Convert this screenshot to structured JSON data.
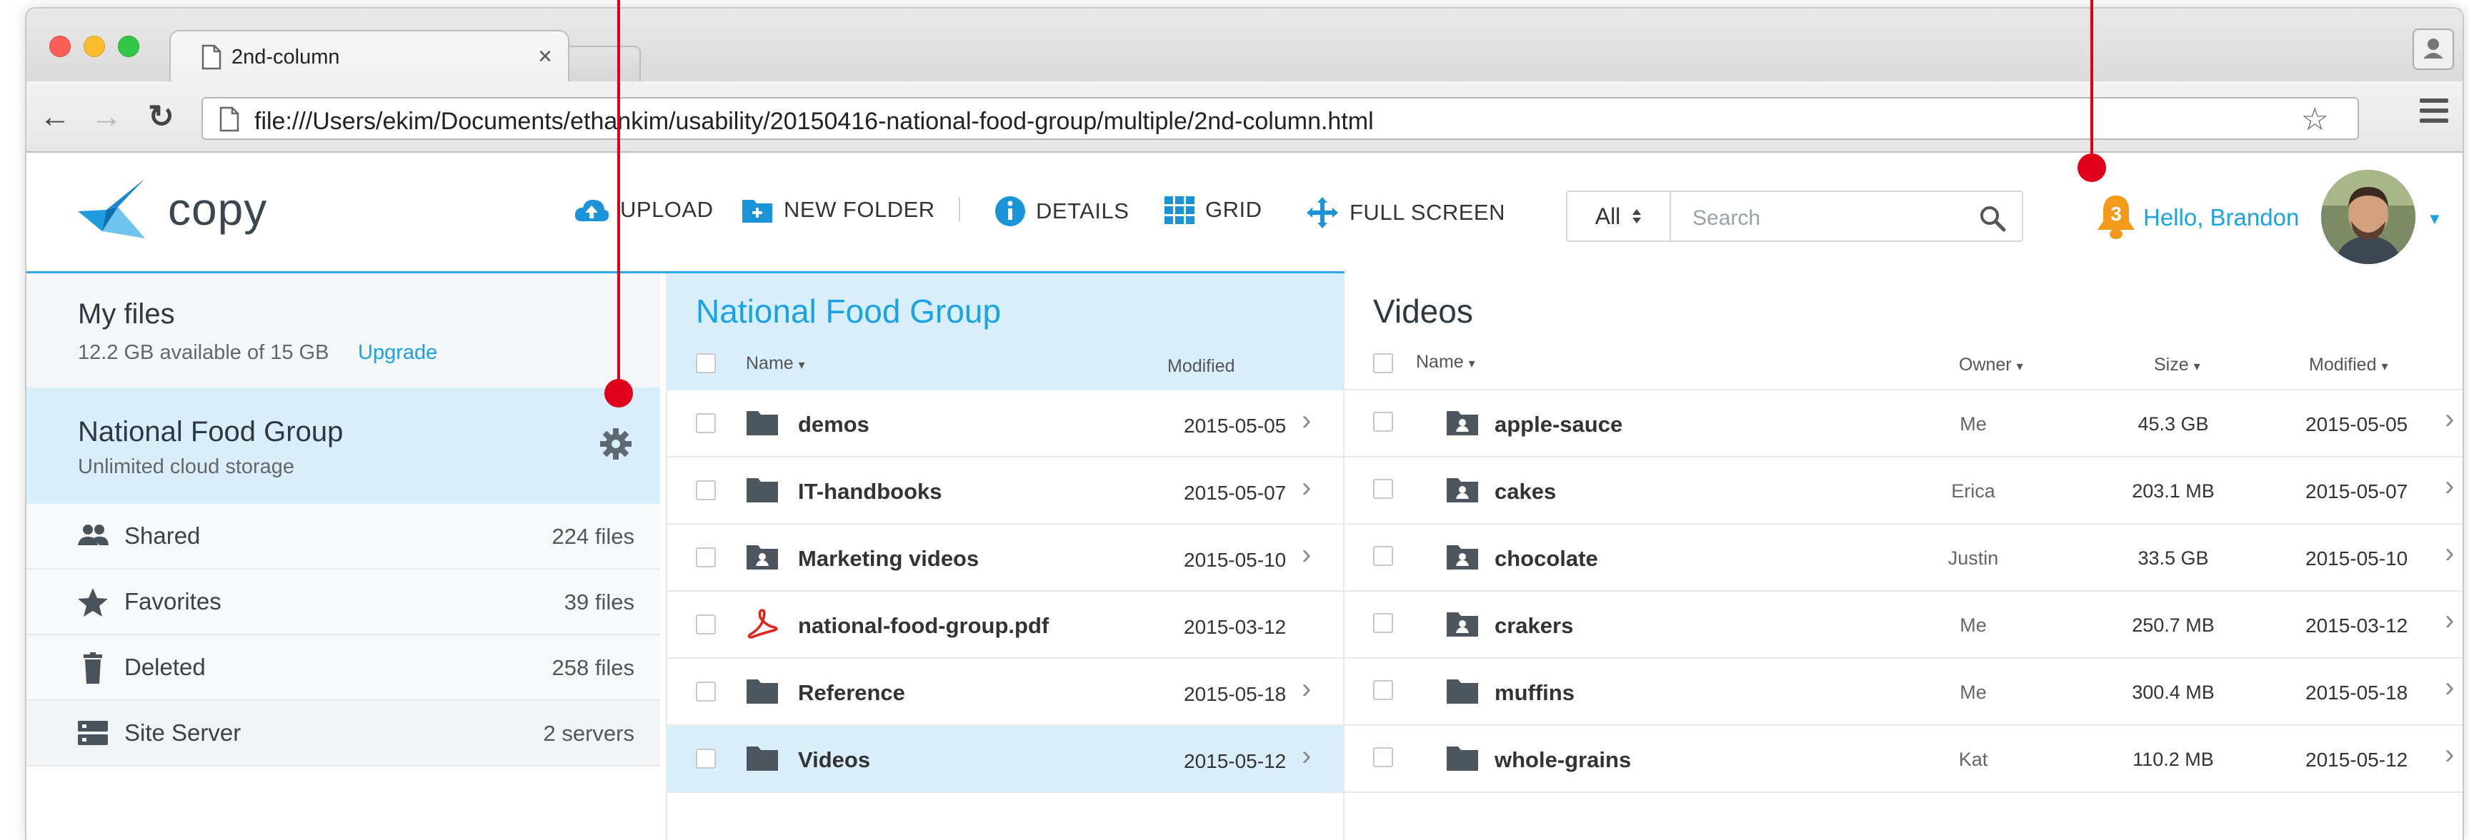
{
  "browser": {
    "tab_title": "2nd-column",
    "tab_close": "×",
    "url": "file:///Users/ekim/Documents/ethankim/usability/20150416-national-food-group/multiple/2nd-column.html",
    "traffic_colors": [
      "#fc5f57",
      "#fdbc2e",
      "#33c748"
    ]
  },
  "app": {
    "logo_text": "copy",
    "toolbar": {
      "upload": "UPLOAD",
      "new_folder": "NEW FOLDER",
      "details": "DETAILS",
      "grid": "GRID",
      "full_screen": "FULL SCREEN"
    },
    "search": {
      "scope": "All",
      "placeholder": "Search"
    },
    "notifications": {
      "count": "3"
    },
    "greeting": "Hello, Brandon",
    "accent": "#1aa3e4"
  },
  "sidebar": {
    "my_files": {
      "title": "My files",
      "storage": "12.2 GB available of 15 GB",
      "upgrade": "Upgrade"
    },
    "active_group": {
      "title": "National Food Group",
      "subtitle": "Unlimited cloud storage"
    },
    "items": [
      {
        "label": "Shared",
        "count": "224 files",
        "icon": "people-icon"
      },
      {
        "label": "Favorites",
        "count": "39 files",
        "icon": "star-icon"
      },
      {
        "label": "Deleted",
        "count": "258 files",
        "icon": "trash-icon"
      },
      {
        "label": "Site Server",
        "count": "2 servers",
        "icon": "server-icon"
      }
    ]
  },
  "middle": {
    "title": "National Food Group",
    "headers": {
      "name": "Name",
      "modified": "Modified"
    },
    "rows": [
      {
        "name": "demos",
        "modified": "2015-05-05",
        "icon": "folder-icon",
        "chevron": true
      },
      {
        "name": "IT-handbooks",
        "modified": "2015-05-07",
        "icon": "folder-icon",
        "chevron": true
      },
      {
        "name": "Marketing videos",
        "modified": "2015-05-10",
        "icon": "shared-folder-icon",
        "chevron": true
      },
      {
        "name": "national-food-group.pdf",
        "modified": "2015-03-12",
        "icon": "pdf-icon",
        "chevron": false
      },
      {
        "name": "Reference",
        "modified": "2015-05-18",
        "icon": "folder-icon",
        "chevron": true
      },
      {
        "name": "Videos",
        "modified": "2015-05-12",
        "icon": "folder-icon",
        "chevron": true,
        "selected": true
      }
    ]
  },
  "right": {
    "title": "Videos",
    "headers": {
      "name": "Name",
      "owner": "Owner",
      "size": "Size",
      "modified": "Modified"
    },
    "rows": [
      {
        "name": "apple-sauce",
        "owner": "Me",
        "size": "45.3 GB",
        "modified": "2015-05-05",
        "icon": "shared-folder-icon"
      },
      {
        "name": "cakes",
        "owner": "Erica",
        "size": "203.1 MB",
        "modified": "2015-05-07",
        "icon": "shared-folder-icon"
      },
      {
        "name": "chocolate",
        "owner": "Justin",
        "size": "33.5 GB",
        "modified": "2015-05-10",
        "icon": "shared-folder-icon"
      },
      {
        "name": "crakers",
        "owner": "Me",
        "size": "250.7 MB",
        "modified": "2015-03-12",
        "icon": "shared-folder-icon"
      },
      {
        "name": "muffins",
        "owner": "Me",
        "size": "300.4 MB",
        "modified": "2015-05-18",
        "icon": "folder-icon"
      },
      {
        "name": "whole-grains",
        "owner": "Kat",
        "size": "110.2 MB",
        "modified": "2015-05-12",
        "icon": "folder-icon"
      }
    ]
  }
}
